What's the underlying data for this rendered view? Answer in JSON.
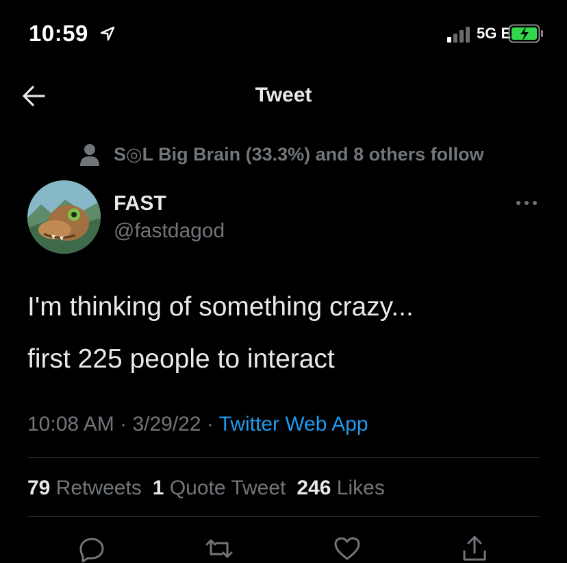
{
  "status_bar": {
    "time": "10:59",
    "network": "5G E",
    "icons": [
      "location-arrow-icon",
      "signal-bars-icon",
      "battery-charging-icon"
    ]
  },
  "header": {
    "title": "Tweet",
    "back_icon": "back-arrow-icon"
  },
  "social_context": {
    "icon": "person-icon",
    "text": "S◎L Big Brain (33.3%) and 8 others follow"
  },
  "author": {
    "name": "FAST",
    "handle": "@fastdagod",
    "more_icon": "more-dots-icon"
  },
  "tweet": {
    "line1": "I'm thinking of something crazy...",
    "line2": "first 225 people to interact"
  },
  "meta": {
    "time": "10:08 AM",
    "sep1": " · ",
    "date": "3/29/22",
    "sep2": " · ",
    "source": "Twitter Web App"
  },
  "stats": {
    "retweets_count": "79",
    "retweets_label": "Retweets",
    "quotes_count": "1",
    "quotes_label": "Quote Tweet",
    "likes_count": "246",
    "likes_label": "Likes"
  },
  "actions": [
    "reply-icon",
    "retweet-icon",
    "like-icon",
    "share-icon"
  ],
  "colors": {
    "background": "#000000",
    "text": "#e7e9ea",
    "secondary": "#71767b",
    "link": "#1d9bf0",
    "battery": "#32d74b"
  }
}
